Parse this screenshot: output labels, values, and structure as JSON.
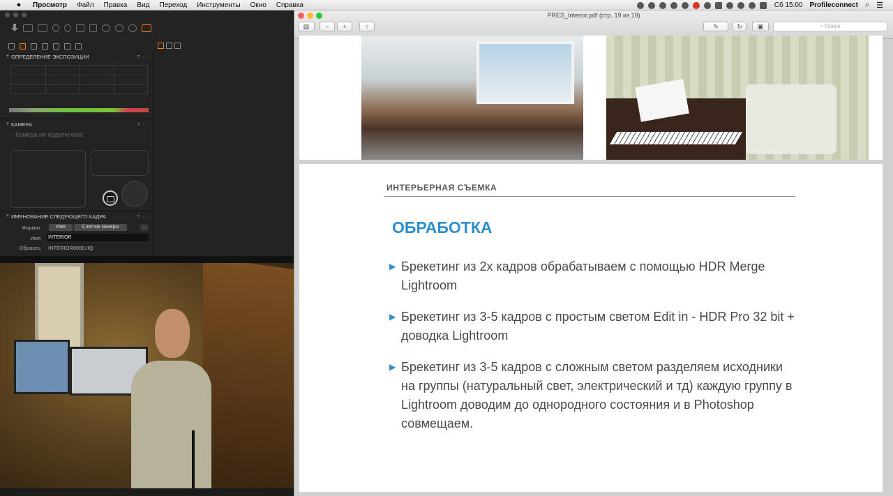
{
  "menubar": {
    "app_name": "Просмотр",
    "menus": [
      "Файл",
      "Правка",
      "Вид",
      "Переход",
      "Инструменты",
      "Окно",
      "Справка"
    ],
    "clock": "Сб 15:00",
    "user": "Profileconnect"
  },
  "capture": {
    "panels": {
      "exposure": {
        "title": "ОПРЕДЕЛЕНИЕ ЭКСПОЗИЦИИ",
        "q": "? ···"
      },
      "camera": {
        "title": "КАМЕРА",
        "q": "? ···",
        "status": "Камера не подключена"
      },
      "naming": {
        "title": "ИМЕНОВАНИЕ СЛЕДУЮЩЕГО КАДРА",
        "q": "? ···"
      }
    },
    "naming": {
      "format_label": "Формат",
      "format_tokens": [
        "Имя",
        "Счетчик камеры"
      ],
      "more": "...",
      "name_label": "Имя",
      "name_value": "INTERIOR",
      "sample_label": "Образец",
      "sample_value": "INTERIOR0000.IIQ"
    }
  },
  "preview": {
    "title": "PRES_Interior.pdf (стр. 19 из 19)",
    "search_placeholder": "Поиск",
    "slide": {
      "section": "ИНТЕРЬЕРНАЯ СЪЕМКА",
      "heading": "ОБРАБОТКА",
      "bullets": [
        "Брекетинг из 2х кадров обрабатываем с помощью HDR Merge Lightroom",
        "Брекетинг из 3-5 кадров с простым светом Edit in - HDR Pro 32 bit + доводка Lightroom",
        "Брекетинг из 3-5 кадров с сложным светом разделяем исходники на группы (натуральный свет, электрический и тд) каждую группу в Lightroom доводим до однородного состояния и в Photoshop совмещаем."
      ]
    }
  },
  "colors": {
    "accent_blue": "#2e8fcf",
    "capture_orange": "#ff7b1c"
  }
}
